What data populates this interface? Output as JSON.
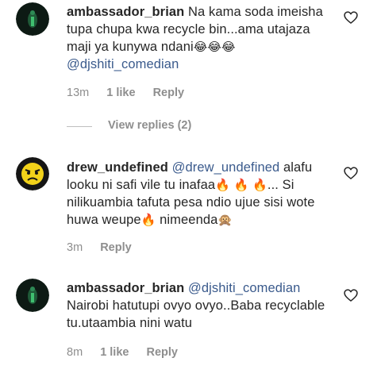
{
  "comments": [
    {
      "username": "ambassador_brian",
      "text": "Na kama soda imeisha tupa chupa kwa recycle bin...ama utajaza maji ya kunywa ndani",
      "emojis": "😂😂😂",
      "mention": "@djshiti_comedian",
      "time": "13m",
      "likes": "1 like",
      "reply": "Reply"
    },
    {
      "username": "drew_undefined",
      "mention": "@drew_undefined",
      "text_a": "alafu looku ni safi vile tu inafaa",
      "fire1": "🔥",
      "fire2": "🔥",
      "fire3": "🔥",
      "text_b": "... Si nilikuambia tafuta pesa ndio ujue sisi wote huwa weupe",
      "fire4": "🔥",
      "text_c": "nimeenda",
      "monkey": "🙊",
      "time": "3m",
      "reply": "Reply"
    },
    {
      "username": "ambassador_brian",
      "mention": "@djshiti_comedian",
      "text": "Nairobi hatutupi ovyo ovyo..Baba recyclable tu.utaambia nini watu",
      "time": "8m",
      "likes": "1 like",
      "reply": "Reply"
    }
  ],
  "view_replies": "View replies (2)",
  "icons": {
    "like": "heart-outline-icon",
    "avatar1": "green-figure-avatar",
    "avatar2": "yellow-angry-face-avatar",
    "avatar3": "green-figure-avatar"
  },
  "colors": {
    "username": "#262626",
    "mention": "#3a5a8c",
    "meta": "#8e8e8e"
  }
}
